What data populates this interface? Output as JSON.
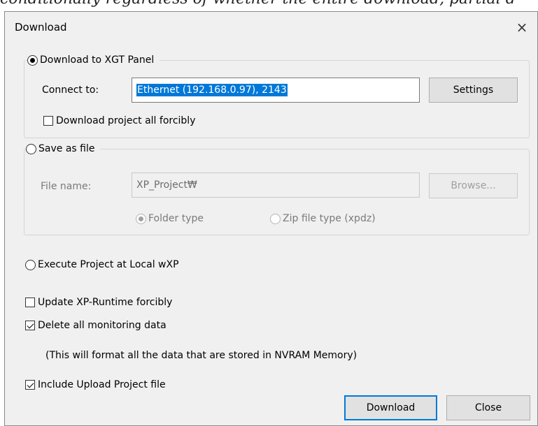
{
  "background_text": "conditionally regardless of whether the entire download, partial d",
  "dialog": {
    "title": "Download",
    "close_symbol": "×"
  },
  "xgt_panel": {
    "label": "Download to XGT Panel",
    "selected": true,
    "connect_label": "Connect to:",
    "connect_value": "Ethernet (192.168.0.97), 2143",
    "settings_button": "Settings",
    "force_label": "Download project all forcibly",
    "force_checked": false
  },
  "save_file": {
    "label": "Save as file",
    "selected": false,
    "filename_label": "File name:",
    "filename_value": "XP_Project₩",
    "browse_button": "Browse...",
    "folder_type": "Folder type",
    "zip_type": "Zip file type (xpdz)"
  },
  "local": {
    "label": "Execute Project at Local wXP",
    "selected": false
  },
  "options": {
    "update_runtime": {
      "label": "Update XP-Runtime forcibly",
      "checked": false
    },
    "delete_monitoring": {
      "label": "Delete all monitoring data",
      "checked": true
    },
    "note": "(This will format all the data that are stored in NVRAM Memory)",
    "include_upload": {
      "label": "Include Upload Project file",
      "checked": true
    }
  },
  "buttons": {
    "download": "Download",
    "close": "Close"
  }
}
